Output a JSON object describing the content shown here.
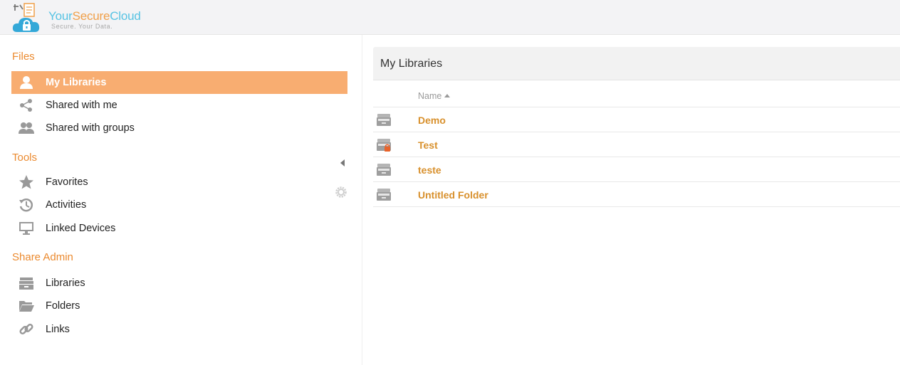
{
  "brand": {
    "name_part1": "Your",
    "name_part2": "Secure",
    "name_part3": "Cloud",
    "tagline": "Secure. Your Data."
  },
  "sidebar": {
    "files_title": "Files",
    "files_items": [
      {
        "label": "My Libraries",
        "icon": "user-icon",
        "active": true
      },
      {
        "label": "Shared with me",
        "icon": "share-icon"
      },
      {
        "label": "Shared with groups",
        "icon": "group-icon"
      }
    ],
    "tools_title": "Tools",
    "tools_items": [
      {
        "label": "Favorites",
        "icon": "star-icon"
      },
      {
        "label": "Activities",
        "icon": "history-icon"
      },
      {
        "label": "Linked Devices",
        "icon": "monitor-icon"
      }
    ],
    "admin_title": "Share Admin",
    "admin_items": [
      {
        "label": "Libraries",
        "icon": "library-icon"
      },
      {
        "label": "Folders",
        "icon": "folder-icon"
      },
      {
        "label": "Links",
        "icon": "link-icon"
      }
    ]
  },
  "main": {
    "title": "My Libraries",
    "column_name": "Name",
    "rows": [
      {
        "name": "Demo",
        "icon": "library-icon",
        "encrypted": false
      },
      {
        "name": "Test",
        "icon": "encrypted-library-icon",
        "encrypted": true
      },
      {
        "name": "teste",
        "icon": "library-icon",
        "encrypted": false
      },
      {
        "name": "Untitled Folder",
        "icon": "library-icon",
        "encrypted": false
      }
    ]
  },
  "colors": {
    "accent": "#eb8a2f",
    "active_bg": "#f8ad71",
    "link": "#d8902c",
    "brand_blue": "#57c3e3"
  }
}
